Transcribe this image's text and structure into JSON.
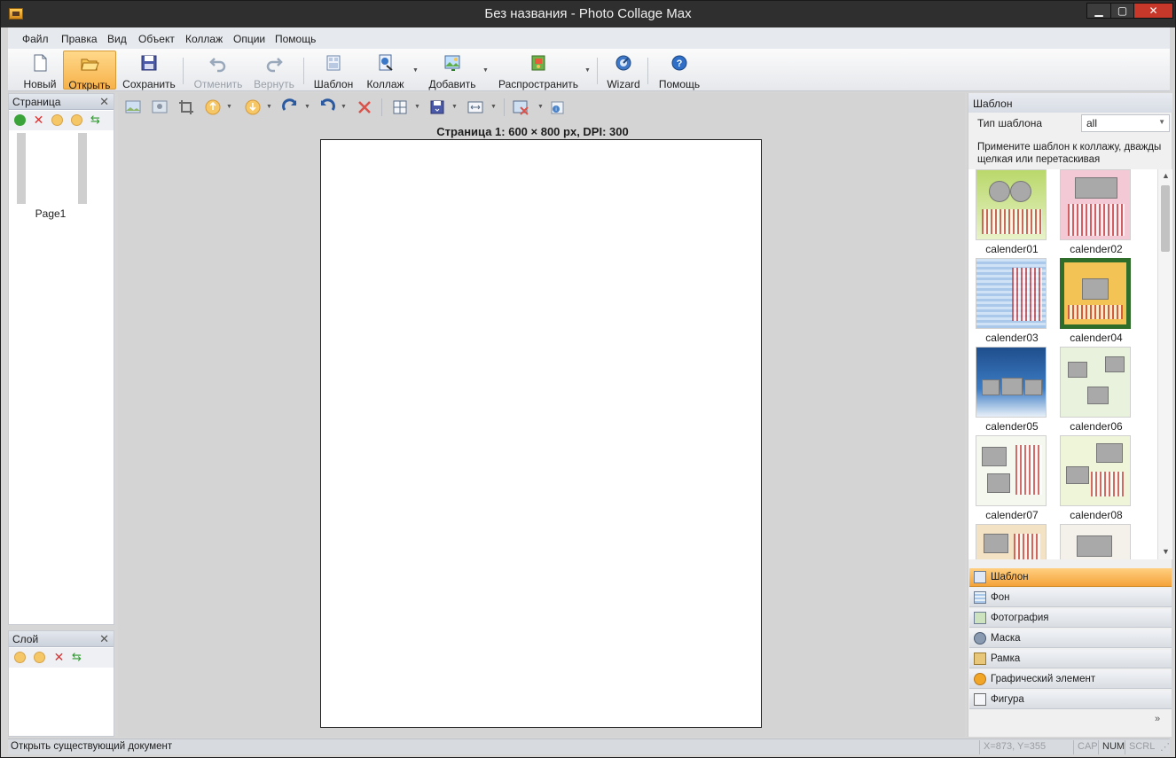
{
  "window": {
    "title": "Без названия - Photo Collage Max"
  },
  "menu": [
    "Файл",
    "Правка",
    "Вид",
    "Объект",
    "Коллаж",
    "Опции",
    "Помощь"
  ],
  "toolbar": {
    "new_label": "Новый",
    "open_label": "Открыть",
    "save_label": "Сохранить",
    "undo_label": "Отменить",
    "redo_label": "Вернуть",
    "template_label": "Шаблон",
    "collage_label": "Коллаж",
    "add_label": "Добавить",
    "share_label": "Распространить",
    "wizard_label": "Wizard",
    "help_label": "Помощь"
  },
  "pages_panel": {
    "title": "Страница",
    "pages": [
      "Page1"
    ]
  },
  "layer_panel": {
    "title": "Слой"
  },
  "canvas": {
    "page_info": "Страница 1: 600 × 800 px, DPI: 300"
  },
  "right_panel": {
    "title": "Шаблон",
    "type_label": "Тип шаблона",
    "type_value": "all",
    "hint": "Примените шаблон к коллажу, дважды щелкая или перетаскивая",
    "templates": [
      "calender01",
      "calender02",
      "calender03",
      "calender04",
      "calender05",
      "calender06",
      "calender07",
      "calender08"
    ],
    "tabs": [
      "Шаблон",
      "Фон",
      "Фотография",
      "Маска",
      "Рамка",
      "Графический элемент",
      "Фигура"
    ]
  },
  "statusbar": {
    "text": "Открыть существующий документ",
    "coords": "X=873, Y=355",
    "cap": "CAP",
    "num": "NUM",
    "scrl": "SCRL"
  }
}
